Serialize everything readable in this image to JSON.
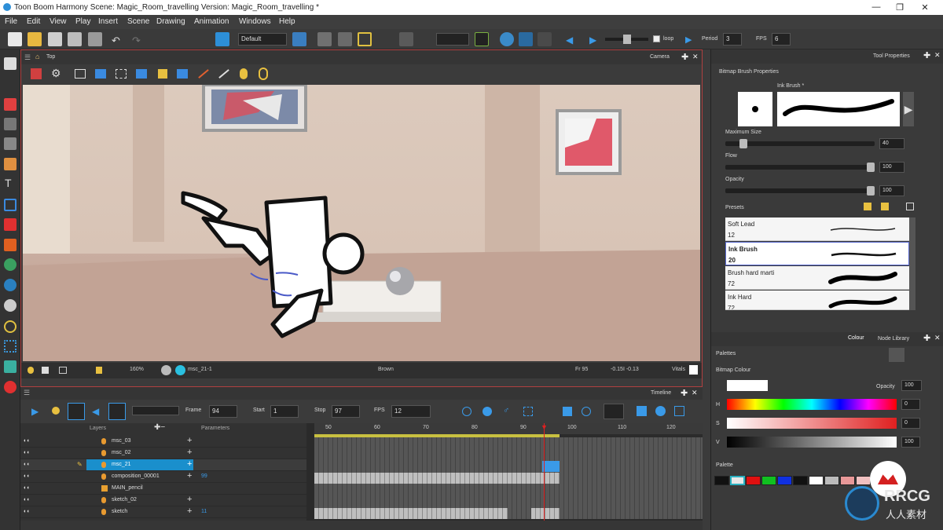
{
  "titlebar": {
    "title": "Toon Boom Harmony Scene: Magic_Room_travelling Version: Magic_Room_travelling *",
    "minimize": "—",
    "maximize": "❐",
    "close": "✕"
  },
  "menu": [
    "File",
    "Edit",
    "View",
    "Play",
    "Insert",
    "Scene",
    "Drawing",
    "Animation",
    "Windows",
    "Help"
  ],
  "toolbar": {
    "workspace_value": "Default",
    "loop_label": "loop",
    "period_label": "Period",
    "period_value": "3",
    "fps_label": "FPS",
    "fps_value": "6"
  },
  "viewport": {
    "breadcrumb": "Top",
    "view_tab": "Camera",
    "status_zoom": "160%",
    "status_drawing": "msc_21-1",
    "status_color": "Brown",
    "status_frame": "Fr 95",
    "status_coords": "-0.15I -0.13",
    "status_mode": "Vitals"
  },
  "timeline": {
    "tab": "Timeline",
    "frame_label": "Frame",
    "frame_value": "94",
    "start_label": "Start",
    "start_value": "1",
    "stop_label": "Stop",
    "stop_value": "97",
    "fps_label": "FPS",
    "fps_value": "12",
    "col_layers": "Layers",
    "col_params": "Parameters",
    "ruler": [
      "50",
      "60",
      "70",
      "80",
      "90",
      "100",
      "110",
      "120"
    ],
    "current_frame": 94,
    "layers": [
      {
        "name": "msc_03",
        "param": ""
      },
      {
        "name": "msc_02",
        "param": ""
      },
      {
        "name": "msc_21",
        "param": ""
      },
      {
        "name": "composition_00001",
        "param": "99"
      },
      {
        "name": "MAIN_pencil",
        "param": ""
      },
      {
        "name": "sketch_02",
        "param": ""
      },
      {
        "name": "sketch",
        "param": "11"
      }
    ]
  },
  "tool_properties": {
    "tab": "Tool Properties",
    "section": "Bitmap Brush Properties",
    "brush_name": "Ink Brush *",
    "max_size_label": "Maximum Size",
    "max_size_value": "40",
    "max_size_fraction": 0.1,
    "flow_label": "Flow",
    "flow_value": "100",
    "flow_fraction": 1.0,
    "opacity_label": "Opacity",
    "opacity_value": "100",
    "opacity_fraction": 1.0,
    "presets_label": "Presets",
    "presets": [
      {
        "name": "Soft Lead",
        "size": "12",
        "selected": false
      },
      {
        "name": "Ink Brush",
        "size": "20",
        "selected": true
      },
      {
        "name": "Brush hard marti",
        "size": "72",
        "selected": false
      },
      {
        "name": "Ink Hard",
        "size": "72",
        "selected": false
      }
    ]
  },
  "colour_panel": {
    "tab_colour": "Colour",
    "tab_node_library": "Node Library",
    "palettes_label": "Palettes",
    "bitmap_colour_label": "Bitmap Colour",
    "opacity_label": "Opacity",
    "opacity_value": "100",
    "h_label": "H",
    "h_value": "0",
    "s_label": "S",
    "s_value": "0",
    "v_label": "V",
    "v_value": "100",
    "palette_label": "Palette",
    "swatches": [
      "#111111",
      "#e8e8e8",
      "#e01010",
      "#10c020",
      "#1030e0",
      "#111111",
      "#ffffff",
      "#bbbbbb",
      "#e89898",
      "#f0c0c0"
    ]
  },
  "watermark": {
    "brand": "RRCG",
    "tagline": "人人素材"
  }
}
